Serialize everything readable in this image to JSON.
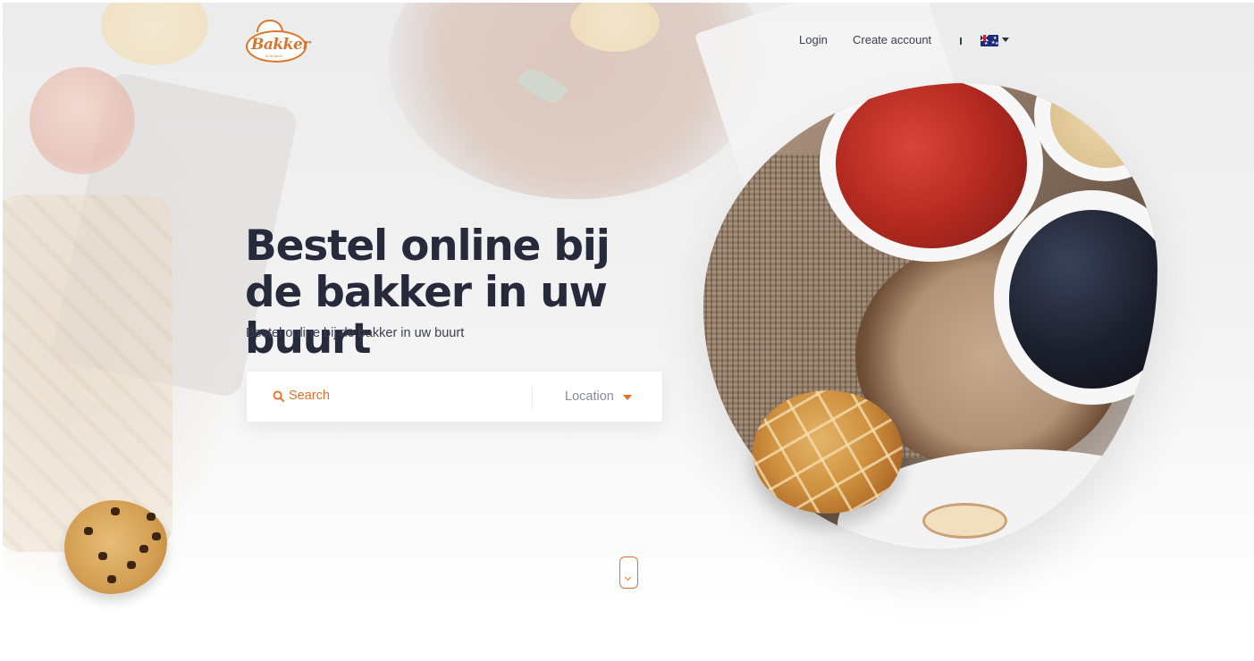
{
  "brand": {
    "logo_text": "Bakker",
    "logo_tagline": "in de buurt",
    "accent_color": "#e37026"
  },
  "nav": {
    "login": "Login",
    "create_account": "Create account",
    "language": "Australian flag (English)"
  },
  "hero": {
    "title": "Bestel online bij de bakker in uw buurt",
    "subtitle": "Bestel online bij de bakker in uw buurt"
  },
  "search": {
    "placeholder": "Search",
    "location_label": "Location"
  },
  "icons": {
    "search": "search-icon",
    "dropdown": "caret-down-icon",
    "scroll": "scroll-down-icon"
  }
}
